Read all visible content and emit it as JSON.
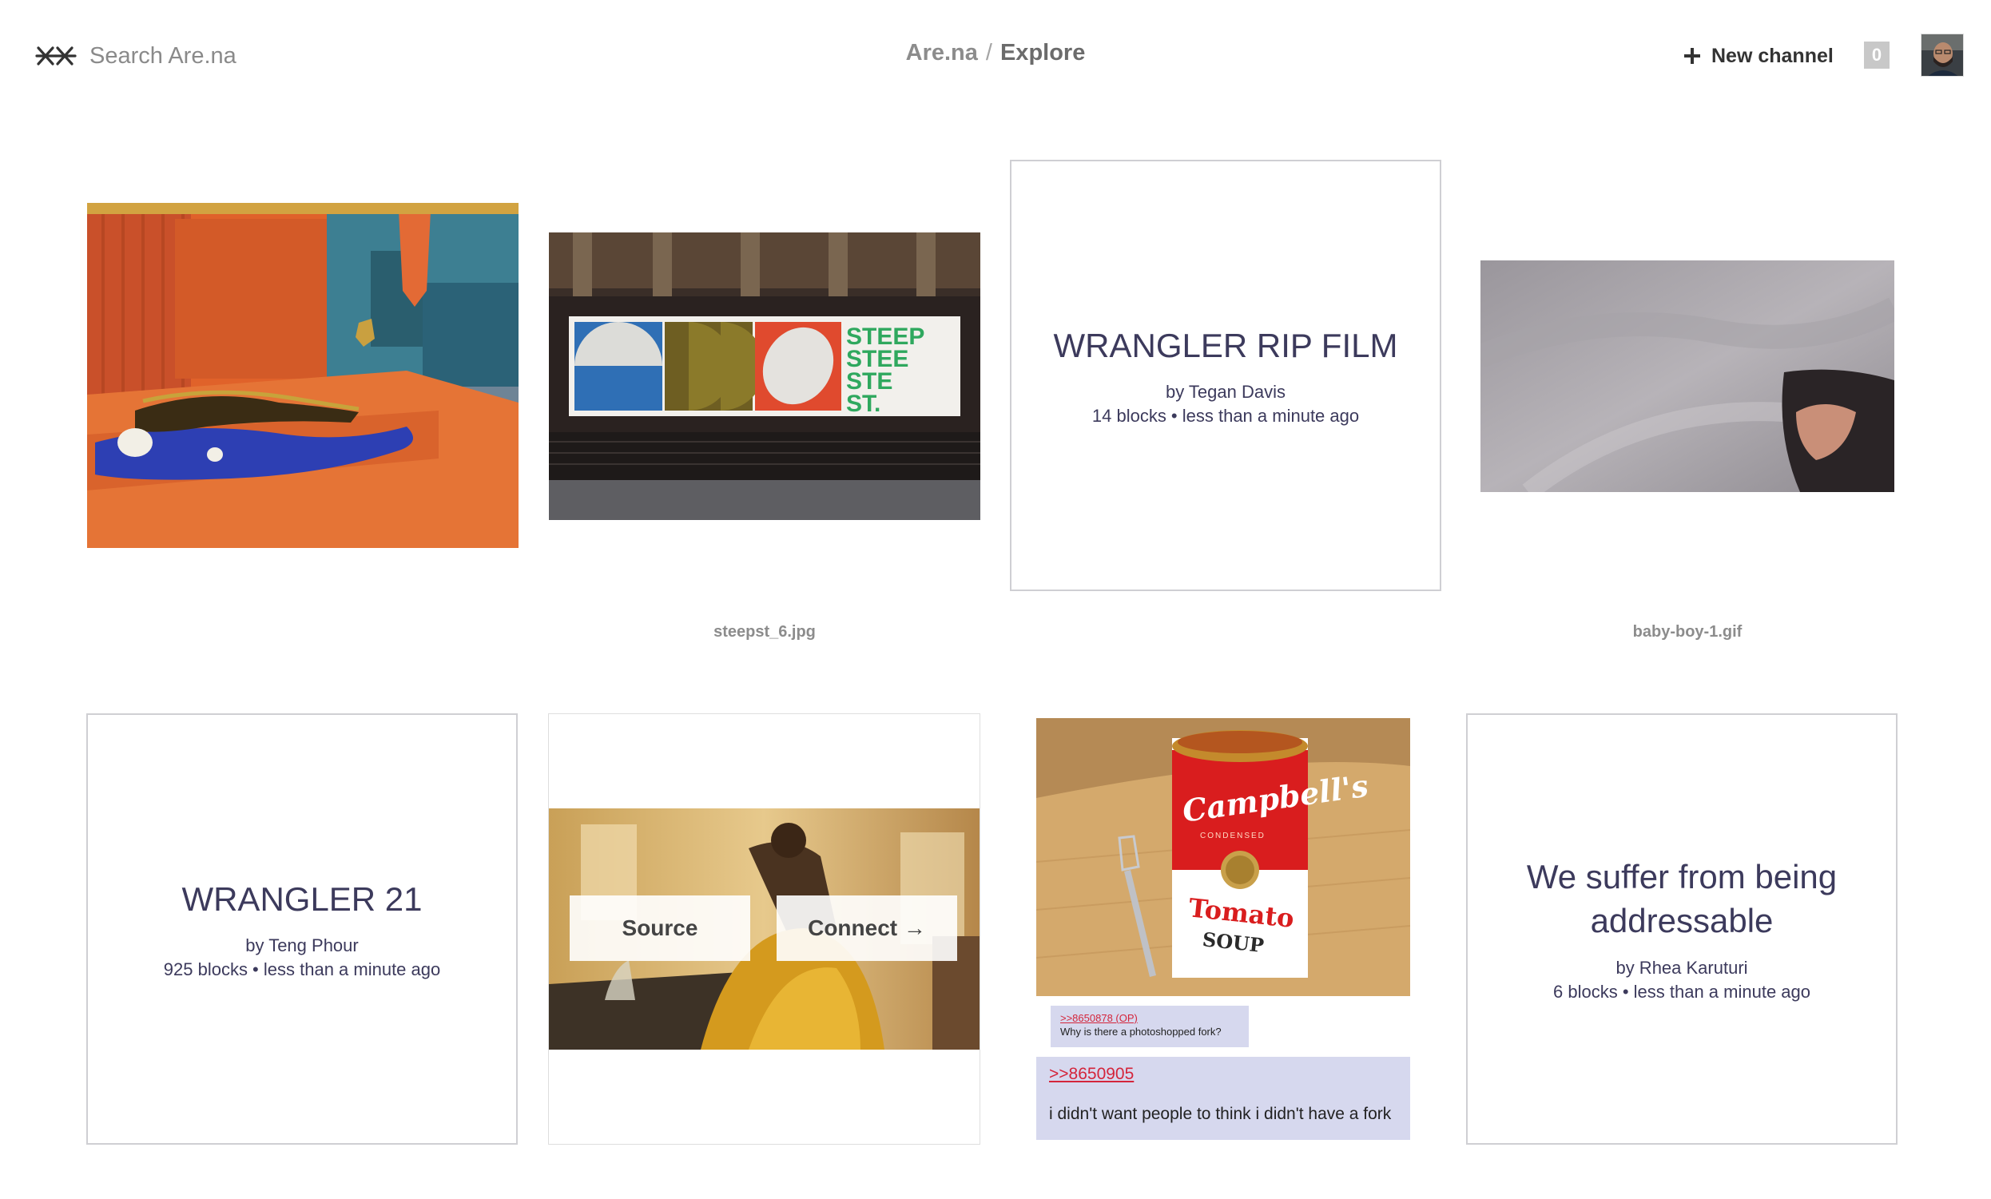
{
  "header": {
    "logo_icon": "arena-star-logo-icon",
    "search_placeholder": "Search Are.na",
    "breadcrumb": {
      "root": "Are.na",
      "separator": "/",
      "current": "Explore"
    },
    "new_channel_label": "New channel",
    "notification_count": "0",
    "avatar_icon": "user-avatar"
  },
  "blocks": [
    {
      "kind": "image",
      "title": "",
      "image": "painting of a reclining dark figure on a blue cloak in an orange room"
    },
    {
      "kind": "image",
      "filename": "steepst_6.jpg",
      "image": "billboard under a railway bridge with geometric shapes",
      "billboard_text": [
        "STEEP",
        "STEE",
        "STE",
        "ST."
      ]
    },
    {
      "kind": "channel",
      "title": "WRANGLER RIP FILM",
      "author": "by Tegan Davis",
      "meta": "14 blocks • less than a minute ago"
    },
    {
      "kind": "image",
      "filename": "baby-boy-1.gif",
      "image": "close-up of grey fabric and dark hair"
    },
    {
      "kind": "channel",
      "title": "WRANGLER 21",
      "author": "by Teng Phour",
      "meta": "925 blocks • less than a minute ago"
    },
    {
      "kind": "image-hover",
      "source_label": "Source",
      "connect_label": "Connect →",
      "image": "woman in yellow dress at a sunlit table"
    },
    {
      "kind": "image",
      "image": "Campbell's tomato soup can with fork",
      "can_brand": "Campbell's",
      "can_sub": "CONDENSED",
      "can_flavor": "Tomato",
      "can_type": "SOUP",
      "replies": [
        {
          "ref": ">>8650878 (OP)",
          "text": "Why is there a photoshopped fork?"
        },
        {
          "ref": ">>8650905",
          "text": "i didn't want people to think i didn't have a fork"
        }
      ]
    },
    {
      "kind": "channel",
      "title": "We suffer from being addressable",
      "author": "by Rhea Karuturi",
      "meta": "6 blocks • less than a minute ago"
    }
  ],
  "colors": {
    "channel_text": "#3c3a5c",
    "channel_border": "#cfcfd3",
    "reply_bg": "#d6d8ee",
    "reply_link": "#d4253b"
  }
}
